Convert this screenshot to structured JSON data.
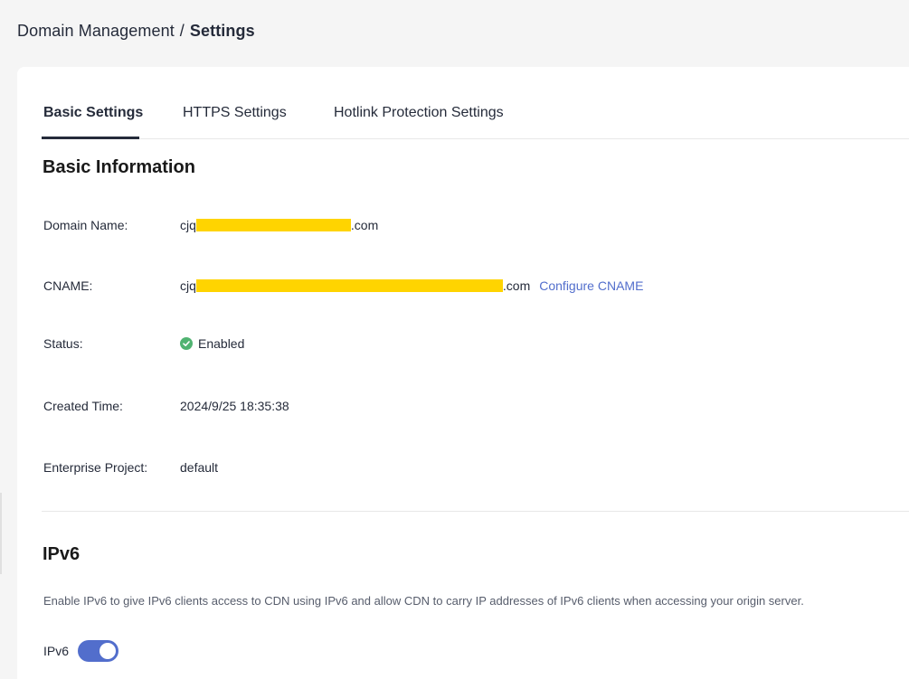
{
  "breadcrumb": {
    "parent": "Domain Management",
    "separator": "/",
    "current": "Settings"
  },
  "tabs": [
    {
      "label": "Basic Settings",
      "active": true
    },
    {
      "label": "HTTPS Settings",
      "active": false
    },
    {
      "label": "Hotlink Protection Settings",
      "active": false
    }
  ],
  "basic_info": {
    "title": "Basic Information",
    "domain_name": {
      "label": "Domain Name:",
      "prefix": "cjq",
      "suffix": ".com"
    },
    "cname": {
      "label": "CNAME:",
      "prefix": "cjq",
      "suffix": ".com",
      "action": "Configure CNAME"
    },
    "status": {
      "label": "Status:",
      "value": "Enabled",
      "icon": "check-circle-icon",
      "color": "#50b371"
    },
    "created_time": {
      "label": "Created Time:",
      "value": "2024/9/25 18:35:38"
    },
    "enterprise_project": {
      "label": "Enterprise Project:",
      "value": "default"
    }
  },
  "ipv6": {
    "title": "IPv6",
    "description": "Enable IPv6 to give IPv6 clients access to CDN using IPv6 and allow CDN to carry IP addresses of IPv6 clients when accessing your origin server.",
    "toggle_label": "IPv6",
    "enabled": true
  },
  "colors": {
    "accent": "#526ecc",
    "redaction": "#ffd400",
    "success": "#50b371"
  }
}
